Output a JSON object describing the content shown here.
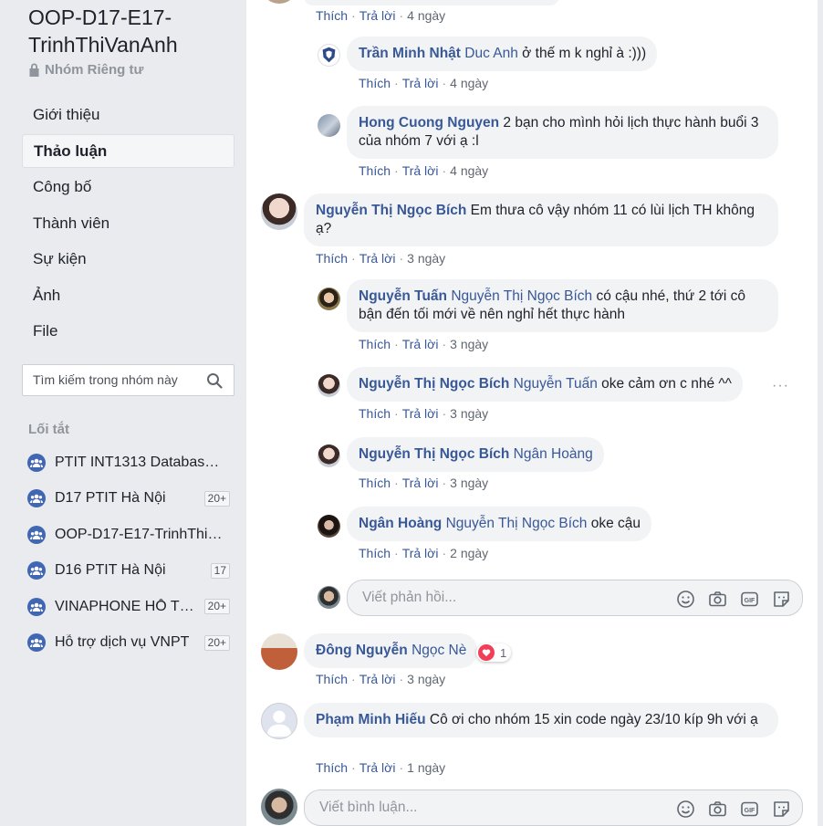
{
  "group": {
    "name": "OOP-D17-E17-TrinhThiVanAnh",
    "privacy": "Nhóm Riêng tư"
  },
  "nav": {
    "items": [
      "Giới thiệu",
      "Thảo luận",
      "Công bố",
      "Thành viên",
      "Sự kiện",
      "Ảnh",
      "File"
    ],
    "active_index": 1
  },
  "search": {
    "placeholder": "Tìm kiếm trong nhóm này"
  },
  "shortcuts": {
    "title": "Lối tắt",
    "items": [
      {
        "label": "PTIT INT1313 Databas…",
        "badge": ""
      },
      {
        "label": "D17 PTIT Hà Nội",
        "badge": "20+"
      },
      {
        "label": "OOP-D17-E17-TrinhThi…",
        "badge": ""
      },
      {
        "label": "D16 PTIT Hà Nội",
        "badge": "17"
      },
      {
        "label": "VINAPHONE HỖ T…",
        "badge": "20+"
      },
      {
        "label": "Hỗ trợ dịch vụ VNPT",
        "badge": "20+"
      }
    ]
  },
  "actions": {
    "like": "Thích",
    "reply": "Trả lời",
    "dot": "·"
  },
  "comments": [
    {
      "time": "4 ngày"
    },
    {
      "author": "Trần Minh Nhật",
      "mention": "Duc Anh",
      "text": " ở thế m k nghỉ à :)))",
      "time": "4 ngày"
    },
    {
      "author": "Hong Cuong Nguyen",
      "mention": "",
      "text": " 2 bạn cho mình hỏi lịch thực hành buổi 3 của nhóm 7 với ạ :l",
      "time": "4 ngày"
    },
    {
      "author": "Nguyễn Thị Ngọc Bích",
      "mention": "",
      "text": " Em thưa cô vậy nhóm 11 có lùi lịch TH không ạ?",
      "time": "3 ngày"
    },
    {
      "author": "Nguyễn Tuấn",
      "mention": "Nguyễn Thị Ngọc Bích",
      "text": " có cậu nhé, thứ 2 tới cô bận đến tối mới về nên nghỉ hết thực hành",
      "time": "3 ngày"
    },
    {
      "author": "Nguyễn Thị Ngọc Bích",
      "mention": "Nguyễn Tuấn",
      "text": " oke cảm ơn c nhé ^^",
      "time": "3 ngày"
    },
    {
      "author": "Nguyễn Thị Ngọc Bích",
      "mention": "Ngân Hoàng",
      "text": "",
      "time": "3 ngày"
    },
    {
      "author": "Ngân Hoàng",
      "mention": "Nguyễn Thị Ngọc Bích",
      "text": " oke cậu",
      "time": "2 ngày"
    },
    {
      "author": "Đông Nguyễn",
      "mention": "Ngọc Nè",
      "text": "",
      "time": "3 ngày",
      "reactions": "1"
    },
    {
      "author": "Phạm Minh Hiếu",
      "mention": "",
      "text": " Cô ơi cho nhóm 15 xin code ngày 23/10 kíp 9h với ạ",
      "time": "1 ngày"
    }
  ],
  "reply_box": {
    "placeholder": "Viết phản hồi..."
  },
  "comment_box": {
    "placeholder": "Viết bình luận..."
  },
  "more": "···",
  "colors": {
    "link": "#385898",
    "brand": "#4267b2",
    "bubble": "#f2f3f5",
    "heart": "#f33e58"
  }
}
